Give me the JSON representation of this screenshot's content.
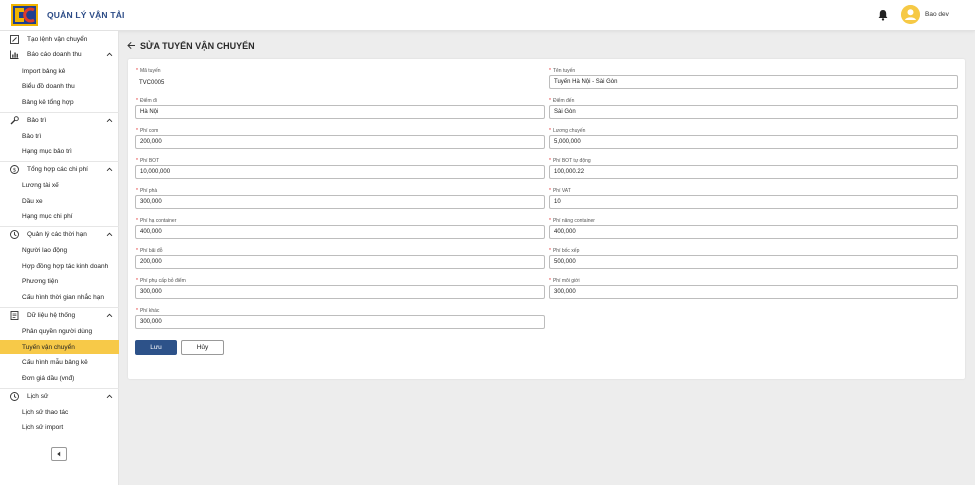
{
  "app": {
    "title": "QUẢN LÝ VẬN TẢI"
  },
  "user": {
    "name": "Bao dev"
  },
  "sidebar": {
    "top_item": "Tạo lệnh vận chuyển",
    "groups": [
      {
        "label": "Báo cáo doanh thu",
        "items": [
          "Import bảng kê",
          "Biểu đồ doanh thu",
          "Bảng kê tổng hợp"
        ]
      },
      {
        "label": "Bảo trì",
        "items": [
          "Bảo trì",
          "Hạng mục bảo trì"
        ]
      },
      {
        "label": "Tổng hợp các chi phí",
        "items": [
          "Lương tài xế",
          "Dầu xe",
          "Hạng mục chi phí"
        ]
      },
      {
        "label": "Quản lý các thời hạn",
        "items": [
          "Người lao động",
          "Hợp đồng hợp tác kinh doanh",
          "Phương tiện",
          "Cấu hình thời gian nhắc hạn"
        ]
      },
      {
        "label": "Dữ liệu hệ thống",
        "items": [
          "Phân quyền người dùng",
          "Tuyến vận chuyển",
          "Cấu hình mẫu bảng kê",
          "Đơn giá dầu (vnđ)"
        ]
      },
      {
        "label": "Lịch sử",
        "items": [
          "Lịch sử thao tác",
          "Lịch sử import"
        ]
      }
    ],
    "active_item": "Tuyến vận chuyển"
  },
  "page": {
    "title": "SỬA TUYẾN VẬN CHUYỂN"
  },
  "form": {
    "ma_tuyen": {
      "label": "Mã tuyến",
      "value": "TVC0005"
    },
    "ten_tuyen": {
      "label": "Tên tuyến",
      "value": "Tuyến Hà Nội -  Sài Gòn"
    },
    "diem_di": {
      "label": "Điểm đi",
      "value": "Hà Nội"
    },
    "diem_den": {
      "label": "Điểm đến",
      "value": "Sài Gòn"
    },
    "phi_com": {
      "label": "Phí com",
      "value": "200,000"
    },
    "luong_chuyen": {
      "label": "Lương chuyến",
      "value": "5,000,000"
    },
    "phi_bot": {
      "label": "Phí BOT",
      "value": "10,000,000"
    },
    "phi_bot_tu_dong": {
      "label": "Phí BOT tự động",
      "value": "100,000.22"
    },
    "phi_pha": {
      "label": "Phí phà",
      "value": "300,000"
    },
    "phi_vat": {
      "label": "Phí VAT",
      "value": "10"
    },
    "phi_ha_container": {
      "label": "Phí hạ container",
      "value": "400,000"
    },
    "phi_nang_container": {
      "label": "Phí nâng container",
      "value": "400,000"
    },
    "phi_bai_do": {
      "label": "Phí bãi đỗ",
      "value": "200,000"
    },
    "phi_boc_xep": {
      "label": "Phí bốc xếp",
      "value": "500,000"
    },
    "phi_phu_cap_bo_diem": {
      "label": "Phí phụ cấp bỏ điểm",
      "value": "300,000"
    },
    "phi_moi_gioi": {
      "label": "Phí môi giới",
      "value": "300,000"
    },
    "phi_khac": {
      "label": "Phí khác",
      "value": "300,000"
    },
    "required_mark": "*"
  },
  "actions": {
    "save": "Lưu",
    "cancel": "Hủy"
  },
  "colors": {
    "brand": "#2b4b86",
    "active": "#f7c948",
    "primary_button": "#2d5289",
    "required": "#e02424"
  },
  "icons": [
    "logo",
    "bell-icon",
    "avatar-icon",
    "back-arrow-icon",
    "chevron-up-icon",
    "chevron-down-icon",
    "chevron-left-icon"
  ]
}
